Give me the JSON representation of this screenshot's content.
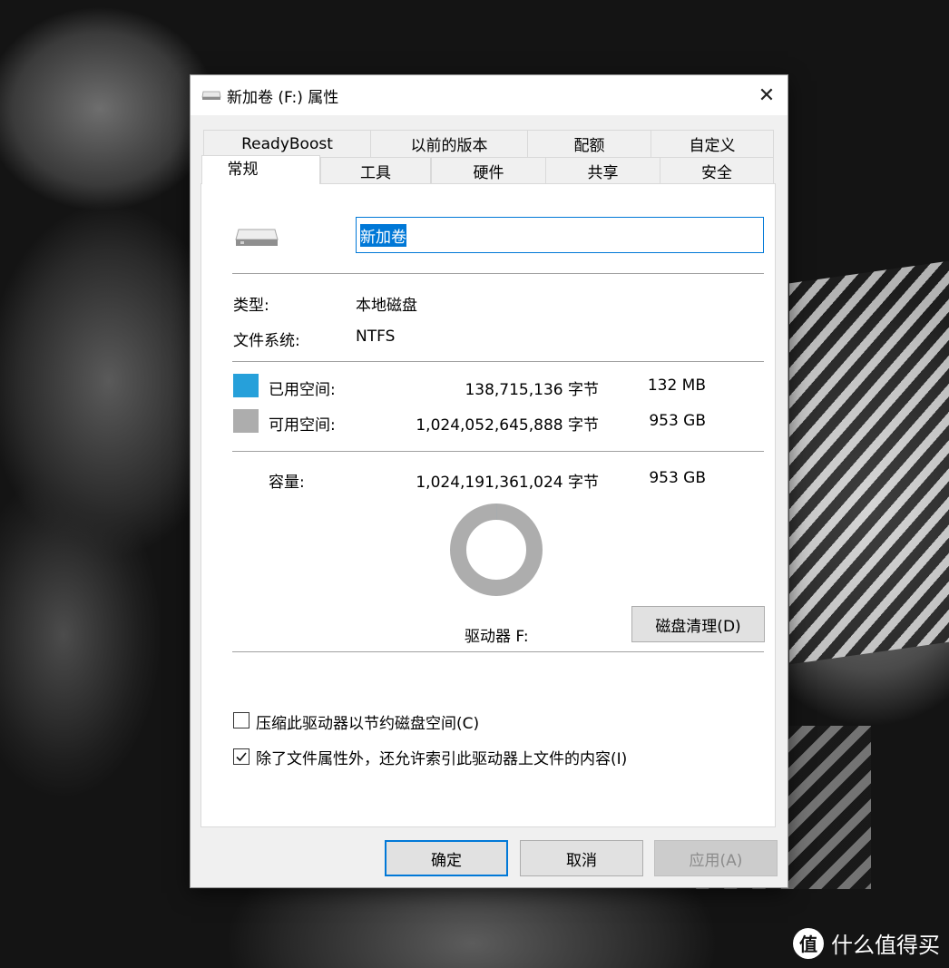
{
  "window": {
    "title": "新加卷 (F:) 属性",
    "close_glyph": "✕"
  },
  "tabs_row1": [
    {
      "label": "ReadyBoost"
    },
    {
      "label": "以前的版本"
    },
    {
      "label": "配额"
    },
    {
      "label": "自定义"
    }
  ],
  "tabs_row2": [
    {
      "label": "常规",
      "active": true
    },
    {
      "label": "工具"
    },
    {
      "label": "硬件"
    },
    {
      "label": "共享"
    },
    {
      "label": "安全"
    }
  ],
  "general": {
    "volume_name": "新加卷",
    "type_label": "类型:",
    "type_value": "本地磁盘",
    "fs_label": "文件系统:",
    "fs_value": "NTFS",
    "used_label": "已用空间:",
    "used_bytes": "138,715,136 字节",
    "used_size": "132 MB",
    "free_label": "可用空间:",
    "free_bytes": "1,024,052,645,888 字节",
    "free_size": "953 GB",
    "cap_label": "容量:",
    "cap_bytes": "1,024,191,361,024 字节",
    "cap_size": "953 GB",
    "drive_label": "驱动器 F:",
    "cleanup_button": "磁盘清理(D)",
    "compress_label": "压缩此驱动器以节约磁盘空间(C)",
    "compress_checked": false,
    "index_label": "除了文件属性外，还允许索引此驱动器上文件的内容(I)",
    "index_checked": true,
    "used_fraction": 0.000135
  },
  "buttons": {
    "ok": "确定",
    "cancel": "取消",
    "apply": "应用(A)"
  },
  "colors": {
    "used": "#26a0da",
    "free": "#adadad",
    "accent": "#0078d7"
  },
  "watermark": {
    "logo": "值",
    "text": "什么值得买"
  }
}
